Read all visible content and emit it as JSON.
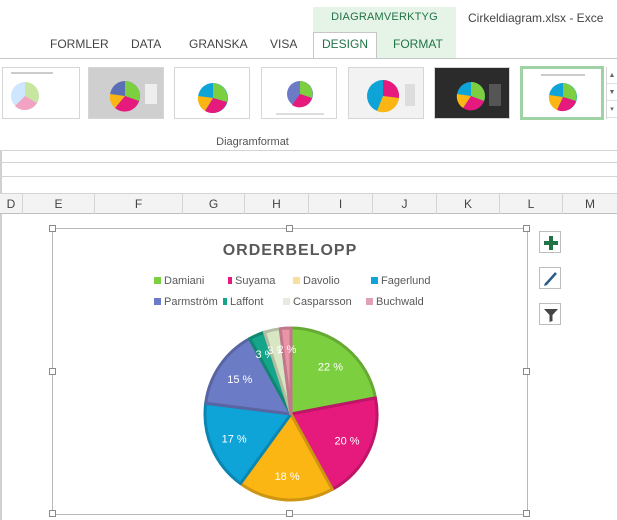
{
  "ribbon": {
    "context_title": "DIAGRAMVERKTYG",
    "document_title": "Cirkeldiagram.xlsx - Exce",
    "tabs": [
      "FORMLER",
      "DATA",
      "GRANSKA",
      "VISA",
      "DESIGN",
      "FORMAT"
    ],
    "active_tab": "DESIGN",
    "group_label": "Diagramformat",
    "accent": "#217346"
  },
  "columns": [
    "D",
    "E",
    "F",
    "G",
    "H",
    "I",
    "J",
    "K",
    "L",
    "M"
  ],
  "chart_data": {
    "type": "pie",
    "title": "ORDERBELOPP",
    "series": [
      {
        "name": "Damiani",
        "value": 22,
        "label": "22 %",
        "color": "#7ccf3f"
      },
      {
        "name": "Suyama",
        "value": 20,
        "label": "20 %",
        "color": "#e6197d"
      },
      {
        "name": "Davolio",
        "value": 18,
        "label": "18 %",
        "color": "#fbb614"
      },
      {
        "name": "Fagerlund",
        "value": 17,
        "label": "17 %",
        "color": "#0ea4d8"
      },
      {
        "name": "Parmström",
        "value": 15,
        "label": "15 %",
        "color": "#6c7bc6"
      },
      {
        "name": "Laffont",
        "value": 3,
        "label": "3 %",
        "color": "#14a58a"
      },
      {
        "name": "Casparsson",
        "value": 3,
        "label": "3 %",
        "color": "#d9e6c4"
      },
      {
        "name": "Buchwald",
        "value": 2,
        "label": "2 %",
        "color": "#ea93a9"
      }
    ],
    "legend_position": "top"
  },
  "icons": {
    "add": "plus-icon",
    "style": "brush-icon",
    "filter": "filter-icon"
  }
}
